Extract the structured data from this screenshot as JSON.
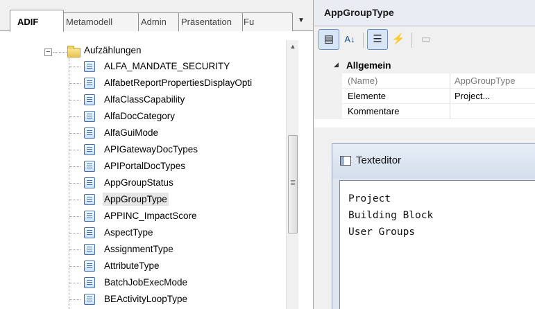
{
  "left_tabs": {
    "tabs": [
      "ADIF",
      "Metamodell",
      "Admin",
      "Präsentation",
      "Fu"
    ],
    "overflow_icon": "dropdown-arrow-icon"
  },
  "tree": {
    "root_label": "Aufzählungen",
    "items": [
      "ALFA_MANDATE_SECURITY",
      "AlfabetReportPropertiesDisplayOpti",
      "AlfaClassCapability",
      "AlfaDocCategory",
      "AlfaGuiMode",
      "APIGatewayDocTypes",
      "APIPortalDocTypes",
      "AppGroupStatus",
      "AppGroupType",
      "APPINC_ImpactScore",
      "AspectType",
      "AssignmentType",
      "AttributeType",
      "BatchJobExecMode",
      "BEActivityLoopType"
    ],
    "selected": "AppGroupType"
  },
  "properties": {
    "title": "AppGroupType",
    "toolbar_icons": [
      "categorized-view-icon",
      "alphabetical-sort-icon",
      "properties-icon",
      "events-icon",
      "property-pages-icon"
    ],
    "category": "Allgemein",
    "rows": [
      {
        "name": "(Name)",
        "value": "AppGroupType"
      },
      {
        "name": "Elemente",
        "value": "Project..."
      },
      {
        "name": "Kommentare",
        "value": ""
      }
    ]
  },
  "texteditor": {
    "title": "Texteditor",
    "lines": [
      "Project",
      "Building Block",
      "User Groups"
    ]
  }
}
